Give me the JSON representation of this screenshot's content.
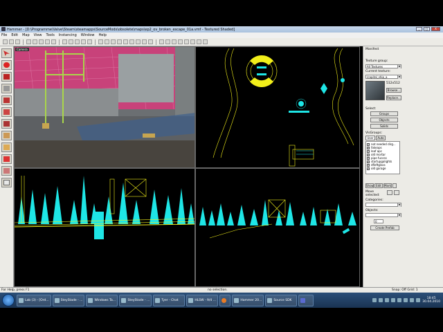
{
  "window": {
    "title": "Hammer - [D:\\Programme\\Valve\\Steam\\steamapps\\SourceMods\\obsolete\\maps\\ep2_ov_broken_escape_01a.vmf - Textured Shaded]",
    "min": "_",
    "max": "□",
    "close": "X"
  },
  "menu": [
    "File",
    "Edit",
    "Map",
    "View",
    "Tools",
    "Instancing",
    "Window",
    "Help"
  ],
  "viewports": {
    "camera_label": "Camera"
  },
  "right_panel": {
    "manifest": "Manifest",
    "texture_group_label": "Texture group:",
    "texture_group_value": "All Textures",
    "current_texture_label": "Current texture:",
    "current_texture_value": "/capital_ship_a",
    "texture_size": "512x512",
    "browse": "Browse...",
    "replace": "Replace...",
    "select_label": "Select:",
    "groups": "Groups",
    "objects": "Objects",
    "solids": "Solids",
    "visgroups_label": "VisGroups:",
    "tab_user": "User",
    "tab_auto": "Auto",
    "visgroups": [
      "not needed dirg...",
      "fakeaps",
      "leaf apc",
      "old mortar",
      "pipe fucces",
      "startupgalights",
      "dfleftglass",
      "old garage"
    ],
    "show": "Show",
    "edit": "Edit",
    "mark": "Mark",
    "move_selected_label": "Move selected:",
    "categories_label": "Categories:",
    "objects_label": "Objects:",
    "objects_value": "0",
    "create_prefab": "Create Prefab"
  },
  "status": {
    "help": "For Help, press F1",
    "selection": "no selection.",
    "snap": "Snap: Off Grid: 1"
  },
  "taskbar": {
    "items": [
      "Lab (3) - [Ord...",
      "SteyStade - ...",
      "Windows Ta...",
      "SteyStade - ...",
      "Tyer - Chat",
      "HLSW - 9/4 ...",
      "",
      "Hammer 20...",
      "Source SDK",
      ""
    ],
    "clock_time": "18:45",
    "clock_date": "30.04.2010"
  },
  "colors": {
    "wire_yellow": "#f2ef1a",
    "wire_cyan": "#1ee6e6",
    "magenta_bg": "#c8427a"
  }
}
